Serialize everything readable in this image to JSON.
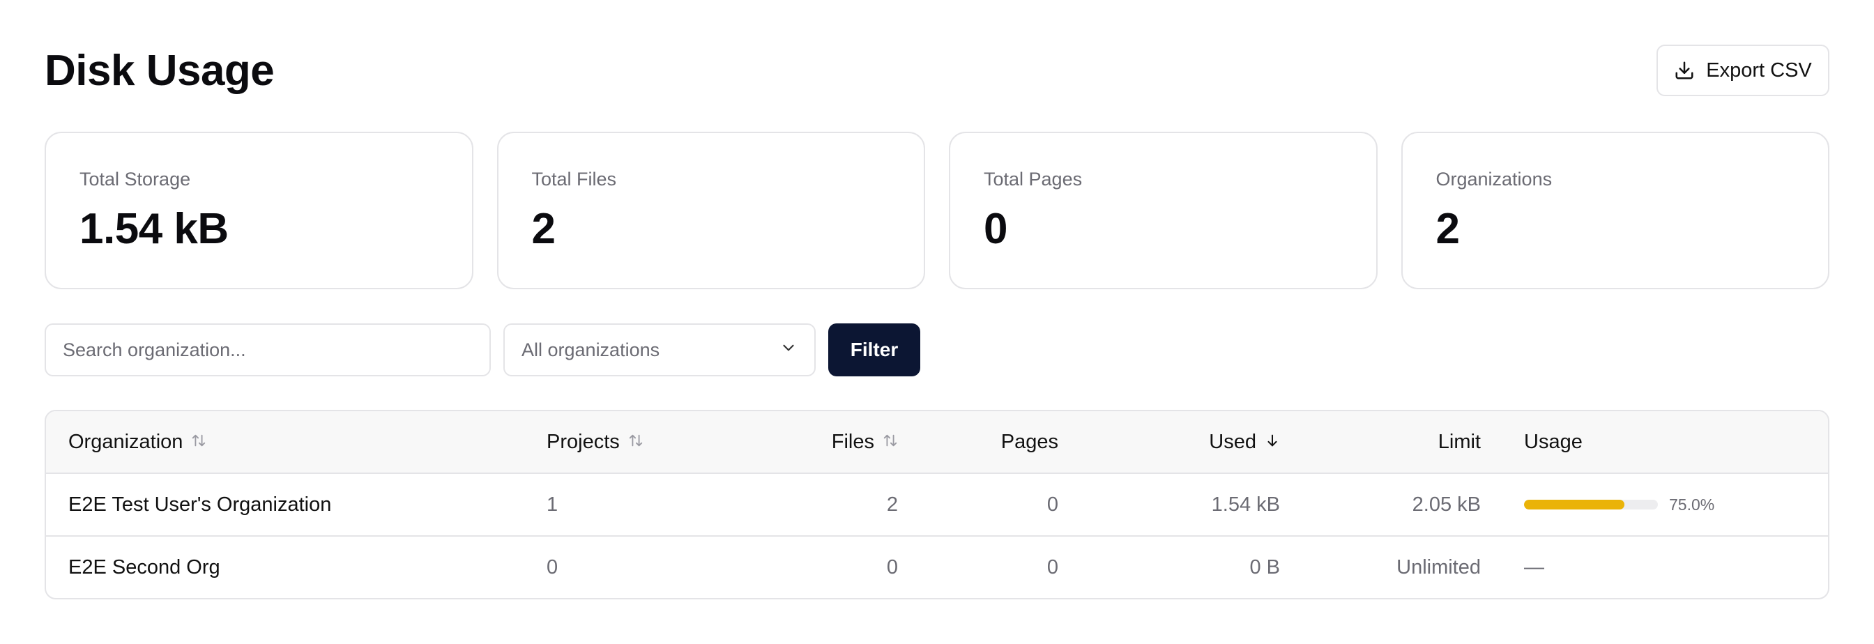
{
  "header": {
    "title": "Disk Usage",
    "export_label": "Export CSV"
  },
  "stats": [
    {
      "label": "Total Storage",
      "value": "1.54 kB"
    },
    {
      "label": "Total Files",
      "value": "2"
    },
    {
      "label": "Total Pages",
      "value": "0"
    },
    {
      "label": "Organizations",
      "value": "2"
    }
  ],
  "filters": {
    "search_placeholder": "Search organization...",
    "search_value": "",
    "select_value": "All organizations",
    "filter_label": "Filter"
  },
  "table": {
    "columns": {
      "organization": "Organization",
      "projects": "Projects",
      "files": "Files",
      "pages": "Pages",
      "used": "Used",
      "limit": "Limit",
      "usage": "Usage"
    },
    "rows": [
      {
        "organization": "E2E Test User's Organization",
        "projects": "1",
        "files": "2",
        "pages": "0",
        "used": "1.54 kB",
        "limit": "2.05 kB",
        "usage_fraction": 0.75,
        "usage_text": "75.0%"
      },
      {
        "organization": "E2E Second Org",
        "projects": "0",
        "files": "0",
        "pages": "0",
        "used": "0 B",
        "limit": "Unlimited",
        "usage_text": "—"
      }
    ]
  },
  "colors": {
    "primary_button": "#0c1633",
    "usage_bar_fill": "#eab308",
    "usage_bar_track": "#ededef",
    "border": "#e4e4e7"
  },
  "icons": {
    "export": "download-icon",
    "select": "chevron-down-icon",
    "sort_neutral": "sort-updown-icon",
    "sort_desc": "arrow-down-icon"
  }
}
